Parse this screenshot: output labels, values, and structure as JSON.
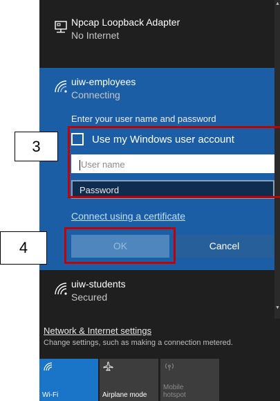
{
  "networks": {
    "loopback": {
      "name": "Npcap Loopback Adapter",
      "status": "No Internet",
      "icon": "ethernet-icon"
    },
    "active": {
      "name": "uiw-employees",
      "status": "Connecting",
      "icon": "wifi-icon",
      "prompt": "Enter your user name and password",
      "checkbox_label": "Use my Windows user account",
      "checkbox_checked": false,
      "username_placeholder": "User name",
      "password_placeholder": "Password",
      "cert_link": "Connect using a certificate",
      "ok_label": "OK",
      "cancel_label": "Cancel"
    },
    "students": {
      "name": "uiw-students",
      "status": "Secured",
      "icon": "wifi-icon"
    }
  },
  "settings": {
    "link": "Network & Internet settings",
    "sub": "Change settings, such as making a connection metered."
  },
  "quick_actions": [
    {
      "label": "Wi-Fi",
      "icon": "wifi-icon",
      "active": true
    },
    {
      "label": "Airplane mode",
      "icon": "airplane-icon",
      "active": false
    },
    {
      "label": "Mobile hotspot",
      "icon": "hotspot-icon",
      "active": false
    }
  ],
  "callouts": {
    "step3": "3",
    "step4": "4"
  },
  "colors": {
    "accent": "#1b5ea5",
    "flyout_bg": "#1f1f1f",
    "callout_red": "#c00000"
  }
}
